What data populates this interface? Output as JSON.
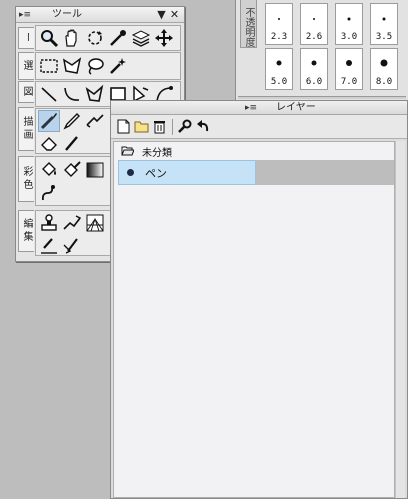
{
  "tool_window": {
    "title": "ツール",
    "grip": "▸≡",
    "minimize": "▼",
    "close": "✕",
    "categories": [
      {
        "label": "ー"
      },
      {
        "label": "選"
      },
      {
        "label": "図"
      },
      {
        "label": "描画"
      },
      {
        "label": "彩色"
      },
      {
        "label": "編集"
      }
    ]
  },
  "brush_panel": {
    "opacity_label": "不透明度",
    "top_sizes": [
      "2.3",
      "2.6",
      "3.0",
      "3.5"
    ],
    "bottom_sizes": [
      "5.0",
      "6.0",
      "7.0",
      "8.0"
    ]
  },
  "layer_panel": {
    "title": "レイヤー",
    "grip": "▸≡",
    "folder_label": "未分類",
    "layers": [
      {
        "name": "ペン",
        "selected": true
      }
    ]
  }
}
